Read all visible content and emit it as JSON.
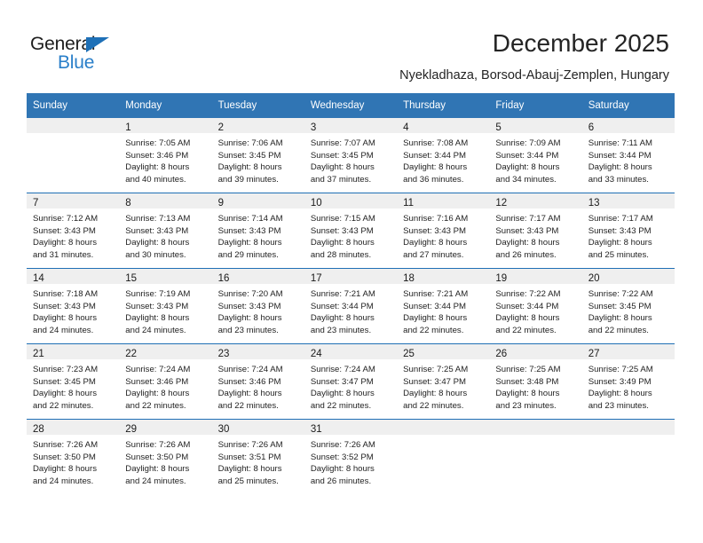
{
  "brand": {
    "name_dark": "General",
    "name_blue": "Blue",
    "accent_color": "#1e70b7",
    "header_color": "#3075b4"
  },
  "header": {
    "title": "December 2025",
    "subtitle": "Nyekladhaza, Borsod-Abauj-Zemplen, Hungary"
  },
  "calendar": {
    "weekday_headers": [
      "Sunday",
      "Monday",
      "Tuesday",
      "Wednesday",
      "Thursday",
      "Friday",
      "Saturday"
    ],
    "weeks": [
      [
        {
          "day": "",
          "lines": []
        },
        {
          "day": "1",
          "lines": [
            "Sunrise: 7:05 AM",
            "Sunset: 3:46 PM",
            "Daylight: 8 hours",
            "and 40 minutes."
          ]
        },
        {
          "day": "2",
          "lines": [
            "Sunrise: 7:06 AM",
            "Sunset: 3:45 PM",
            "Daylight: 8 hours",
            "and 39 minutes."
          ]
        },
        {
          "day": "3",
          "lines": [
            "Sunrise: 7:07 AM",
            "Sunset: 3:45 PM",
            "Daylight: 8 hours",
            "and 37 minutes."
          ]
        },
        {
          "day": "4",
          "lines": [
            "Sunrise: 7:08 AM",
            "Sunset: 3:44 PM",
            "Daylight: 8 hours",
            "and 36 minutes."
          ]
        },
        {
          "day": "5",
          "lines": [
            "Sunrise: 7:09 AM",
            "Sunset: 3:44 PM",
            "Daylight: 8 hours",
            "and 34 minutes."
          ]
        },
        {
          "day": "6",
          "lines": [
            "Sunrise: 7:11 AM",
            "Sunset: 3:44 PM",
            "Daylight: 8 hours",
            "and 33 minutes."
          ]
        }
      ],
      [
        {
          "day": "7",
          "lines": [
            "Sunrise: 7:12 AM",
            "Sunset: 3:43 PM",
            "Daylight: 8 hours",
            "and 31 minutes."
          ]
        },
        {
          "day": "8",
          "lines": [
            "Sunrise: 7:13 AM",
            "Sunset: 3:43 PM",
            "Daylight: 8 hours",
            "and 30 minutes."
          ]
        },
        {
          "day": "9",
          "lines": [
            "Sunrise: 7:14 AM",
            "Sunset: 3:43 PM",
            "Daylight: 8 hours",
            "and 29 minutes."
          ]
        },
        {
          "day": "10",
          "lines": [
            "Sunrise: 7:15 AM",
            "Sunset: 3:43 PM",
            "Daylight: 8 hours",
            "and 28 minutes."
          ]
        },
        {
          "day": "11",
          "lines": [
            "Sunrise: 7:16 AM",
            "Sunset: 3:43 PM",
            "Daylight: 8 hours",
            "and 27 minutes."
          ]
        },
        {
          "day": "12",
          "lines": [
            "Sunrise: 7:17 AM",
            "Sunset: 3:43 PM",
            "Daylight: 8 hours",
            "and 26 minutes."
          ]
        },
        {
          "day": "13",
          "lines": [
            "Sunrise: 7:17 AM",
            "Sunset: 3:43 PM",
            "Daylight: 8 hours",
            "and 25 minutes."
          ]
        }
      ],
      [
        {
          "day": "14",
          "lines": [
            "Sunrise: 7:18 AM",
            "Sunset: 3:43 PM",
            "Daylight: 8 hours",
            "and 24 minutes."
          ]
        },
        {
          "day": "15",
          "lines": [
            "Sunrise: 7:19 AM",
            "Sunset: 3:43 PM",
            "Daylight: 8 hours",
            "and 24 minutes."
          ]
        },
        {
          "day": "16",
          "lines": [
            "Sunrise: 7:20 AM",
            "Sunset: 3:43 PM",
            "Daylight: 8 hours",
            "and 23 minutes."
          ]
        },
        {
          "day": "17",
          "lines": [
            "Sunrise: 7:21 AM",
            "Sunset: 3:44 PM",
            "Daylight: 8 hours",
            "and 23 minutes."
          ]
        },
        {
          "day": "18",
          "lines": [
            "Sunrise: 7:21 AM",
            "Sunset: 3:44 PM",
            "Daylight: 8 hours",
            "and 22 minutes."
          ]
        },
        {
          "day": "19",
          "lines": [
            "Sunrise: 7:22 AM",
            "Sunset: 3:44 PM",
            "Daylight: 8 hours",
            "and 22 minutes."
          ]
        },
        {
          "day": "20",
          "lines": [
            "Sunrise: 7:22 AM",
            "Sunset: 3:45 PM",
            "Daylight: 8 hours",
            "and 22 minutes."
          ]
        }
      ],
      [
        {
          "day": "21",
          "lines": [
            "Sunrise: 7:23 AM",
            "Sunset: 3:45 PM",
            "Daylight: 8 hours",
            "and 22 minutes."
          ]
        },
        {
          "day": "22",
          "lines": [
            "Sunrise: 7:24 AM",
            "Sunset: 3:46 PM",
            "Daylight: 8 hours",
            "and 22 minutes."
          ]
        },
        {
          "day": "23",
          "lines": [
            "Sunrise: 7:24 AM",
            "Sunset: 3:46 PM",
            "Daylight: 8 hours",
            "and 22 minutes."
          ]
        },
        {
          "day": "24",
          "lines": [
            "Sunrise: 7:24 AM",
            "Sunset: 3:47 PM",
            "Daylight: 8 hours",
            "and 22 minutes."
          ]
        },
        {
          "day": "25",
          "lines": [
            "Sunrise: 7:25 AM",
            "Sunset: 3:47 PM",
            "Daylight: 8 hours",
            "and 22 minutes."
          ]
        },
        {
          "day": "26",
          "lines": [
            "Sunrise: 7:25 AM",
            "Sunset: 3:48 PM",
            "Daylight: 8 hours",
            "and 23 minutes."
          ]
        },
        {
          "day": "27",
          "lines": [
            "Sunrise: 7:25 AM",
            "Sunset: 3:49 PM",
            "Daylight: 8 hours",
            "and 23 minutes."
          ]
        }
      ],
      [
        {
          "day": "28",
          "lines": [
            "Sunrise: 7:26 AM",
            "Sunset: 3:50 PM",
            "Daylight: 8 hours",
            "and 24 minutes."
          ]
        },
        {
          "day": "29",
          "lines": [
            "Sunrise: 7:26 AM",
            "Sunset: 3:50 PM",
            "Daylight: 8 hours",
            "and 24 minutes."
          ]
        },
        {
          "day": "30",
          "lines": [
            "Sunrise: 7:26 AM",
            "Sunset: 3:51 PM",
            "Daylight: 8 hours",
            "and 25 minutes."
          ]
        },
        {
          "day": "31",
          "lines": [
            "Sunrise: 7:26 AM",
            "Sunset: 3:52 PM",
            "Daylight: 8 hours",
            "and 26 minutes."
          ]
        },
        {
          "day": "",
          "lines": []
        },
        {
          "day": "",
          "lines": []
        },
        {
          "day": "",
          "lines": []
        }
      ]
    ]
  }
}
